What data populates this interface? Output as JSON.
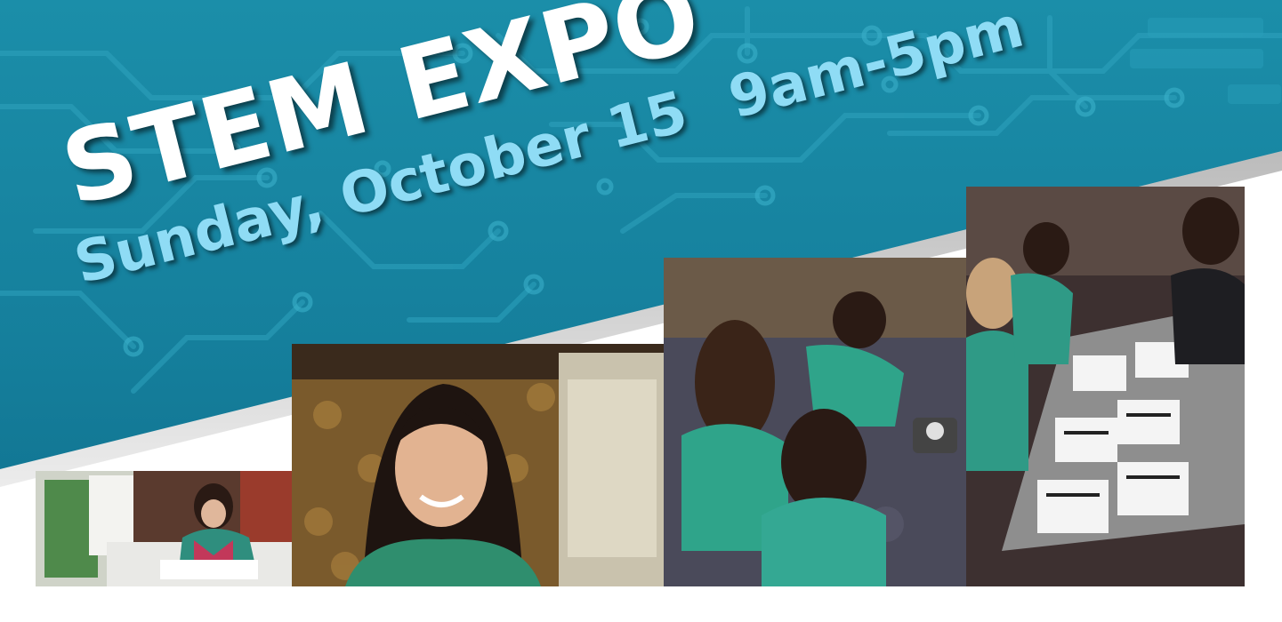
{
  "banner": {
    "title": "STEM EXPO",
    "date": "Sunday, October 15",
    "time": "9am-5pm",
    "colors": {
      "banner_teal": "#1b8ea9",
      "title_white": "#ffffff",
      "date_light_blue": "#8fdcf5"
    }
  },
  "photos": [
    {
      "subject": "girl-writing-photo"
    },
    {
      "subject": "smiling-girl-photo"
    },
    {
      "subject": "girls-with-robot-photo"
    },
    {
      "subject": "girls-at-activity-table-photo"
    }
  ]
}
